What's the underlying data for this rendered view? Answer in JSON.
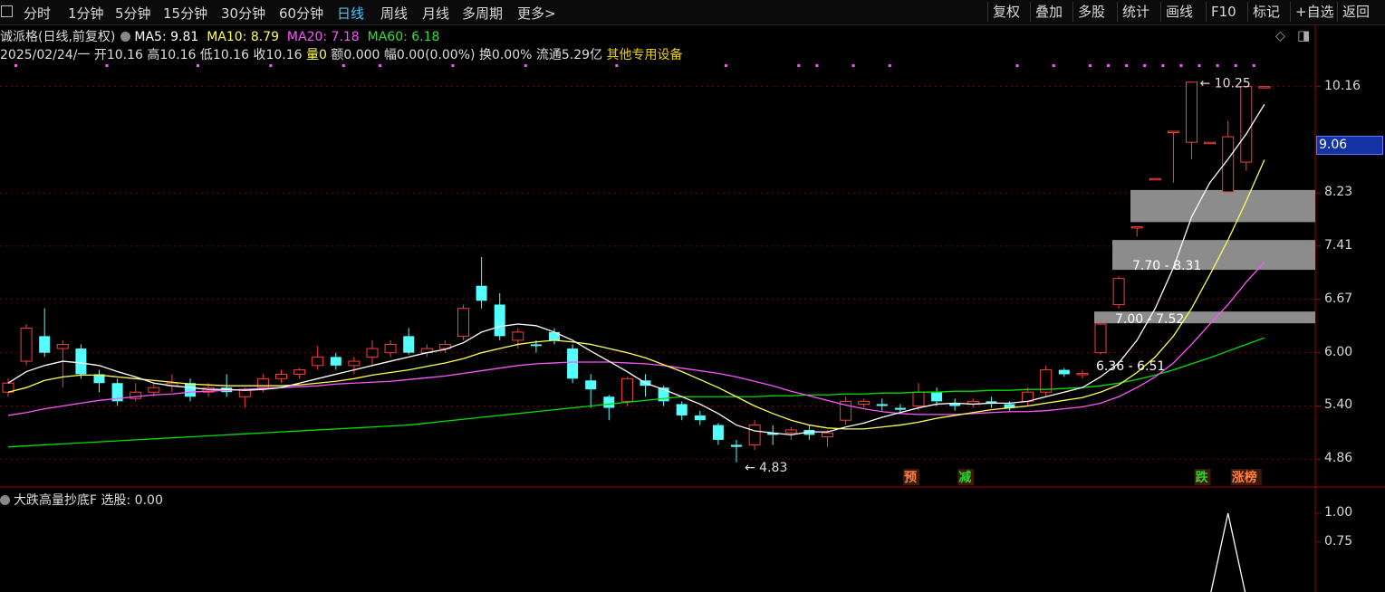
{
  "toolbar": {
    "periods": [
      "分时",
      "1分钟",
      "5分钟",
      "15分钟",
      "30分钟",
      "60分钟",
      "日线",
      "周线",
      "月线",
      "多周期",
      "更多>"
    ],
    "active_period": "日线",
    "buttons": [
      "复权",
      "叠加",
      "多股",
      "统计",
      "画线",
      "F10",
      "标记",
      "+自选",
      "返回"
    ]
  },
  "stock": {
    "name": "诚派格(日线,前复权)",
    "ma5": "MA5: 9.81",
    "ma10": "MA10: 8.79",
    "ma20": "MA20: 7.18",
    "ma60": "MA60: 6.18",
    "ohlc_line": "2025/02/24/一 开10.16 高10.16 低10.16 收10.16",
    "vol_label": "量0",
    "amount": "额0.000",
    "change": "幅0.00(0.00%)",
    "turnover": "换0.00%",
    "float_cap": "流通5.29亿",
    "sector": "其他专用设备"
  },
  "colors": {
    "up": "#ff3c3c",
    "down": "#54ffff",
    "ma5": "#ffffff",
    "ma10": "#ffff54",
    "ma20": "#ff54ff",
    "ma60": "#00e000",
    "grid": "#7a0000",
    "sector": "#e8d000",
    "highlight": "#1434a4"
  },
  "price_axis": {
    "ticks": [
      "10.16",
      "8.23",
      "7.41",
      "6.67",
      "6.00",
      "5.40",
      "4.86"
    ],
    "highlight": "9.06"
  },
  "indicator": {
    "title": "大跌高量抄底F",
    "value": "选股: 0.00",
    "ticks": [
      "1.00",
      "0.75"
    ]
  },
  "chart_data": {
    "type": "candlestick",
    "ylim": [
      4.6,
      10.6
    ],
    "candles": [
      {
        "o": 5.55,
        "c": 5.65,
        "h": 5.7,
        "l": 5.5
      },
      {
        "o": 5.9,
        "c": 6.3,
        "h": 6.35,
        "l": 5.85
      },
      {
        "o": 6.2,
        "c": 6.0,
        "h": 6.55,
        "l": 5.95
      },
      {
        "o": 6.05,
        "c": 6.1,
        "h": 6.15,
        "l": 5.6
      },
      {
        "o": 6.05,
        "c": 5.75,
        "h": 6.1,
        "l": 5.7
      },
      {
        "o": 5.75,
        "c": 5.65,
        "h": 5.8,
        "l": 5.55
      },
      {
        "o": 5.65,
        "c": 5.45,
        "h": 5.7,
        "l": 5.4
      },
      {
        "o": 5.48,
        "c": 5.55,
        "h": 5.65,
        "l": 5.45
      },
      {
        "o": 5.55,
        "c": 5.6,
        "h": 5.65,
        "l": 5.5
      },
      {
        "o": 5.62,
        "c": 5.65,
        "h": 5.75,
        "l": 5.55
      },
      {
        "o": 5.65,
        "c": 5.5,
        "h": 5.7,
        "l": 5.45
      },
      {
        "o": 5.55,
        "c": 5.6,
        "h": 5.65,
        "l": 5.5
      },
      {
        "o": 5.6,
        "c": 5.55,
        "h": 5.75,
        "l": 5.5
      },
      {
        "o": 5.5,
        "c": 5.58,
        "h": 5.6,
        "l": 5.38
      },
      {
        "o": 5.6,
        "c": 5.7,
        "h": 5.75,
        "l": 5.55
      },
      {
        "o": 5.7,
        "c": 5.75,
        "h": 5.8,
        "l": 5.65
      },
      {
        "o": 5.75,
        "c": 5.8,
        "h": 5.82,
        "l": 5.7
      },
      {
        "o": 5.85,
        "c": 5.95,
        "h": 6.08,
        "l": 5.8
      },
      {
        "o": 5.95,
        "c": 5.85,
        "h": 6.0,
        "l": 5.8
      },
      {
        "o": 5.85,
        "c": 5.9,
        "h": 5.95,
        "l": 5.75
      },
      {
        "o": 5.95,
        "c": 6.05,
        "h": 6.15,
        "l": 5.85
      },
      {
        "o": 6.0,
        "c": 6.1,
        "h": 6.15,
        "l": 5.95
      },
      {
        "o": 6.2,
        "c": 6.0,
        "h": 6.3,
        "l": 5.98
      },
      {
        "o": 6.0,
        "c": 6.05,
        "h": 6.1,
        "l": 5.95
      },
      {
        "o": 6.05,
        "c": 6.1,
        "h": 6.15,
        "l": 6.0
      },
      {
        "o": 6.2,
        "c": 6.55,
        "h": 6.6,
        "l": 6.15
      },
      {
        "o": 6.85,
        "c": 6.65,
        "h": 7.25,
        "l": 6.55
      },
      {
        "o": 6.6,
        "c": 6.2,
        "h": 6.75,
        "l": 6.15
      },
      {
        "o": 6.15,
        "c": 6.25,
        "h": 6.3,
        "l": 6.05
      },
      {
        "o": 6.1,
        "c": 6.08,
        "h": 6.15,
        "l": 6.0
      },
      {
        "o": 6.25,
        "c": 6.15,
        "h": 6.3,
        "l": 6.1
      },
      {
        "o": 6.05,
        "c": 5.7,
        "h": 6.1,
        "l": 5.65
      },
      {
        "o": 5.68,
        "c": 5.58,
        "h": 5.75,
        "l": 5.38
      },
      {
        "o": 5.5,
        "c": 5.38,
        "h": 5.52,
        "l": 5.25
      },
      {
        "o": 5.45,
        "c": 5.7,
        "h": 5.72,
        "l": 5.4
      },
      {
        "o": 5.68,
        "c": 5.62,
        "h": 5.75,
        "l": 5.5
      },
      {
        "o": 5.6,
        "c": 5.45,
        "h": 5.62,
        "l": 5.4
      },
      {
        "o": 5.42,
        "c": 5.3,
        "h": 5.45,
        "l": 5.25
      },
      {
        "o": 5.3,
        "c": 5.25,
        "h": 5.35,
        "l": 5.2
      },
      {
        "o": 5.2,
        "c": 5.05,
        "h": 5.22,
        "l": 5.0
      },
      {
        "o": 5.0,
        "c": 4.98,
        "h": 5.05,
        "l": 4.83
      },
      {
        "o": 5.0,
        "c": 5.2,
        "h": 5.25,
        "l": 4.95
      },
      {
        "o": 5.12,
        "c": 5.1,
        "h": 5.2,
        "l": 5.0
      },
      {
        "o": 5.12,
        "c": 5.15,
        "h": 5.18,
        "l": 5.05
      },
      {
        "o": 5.15,
        "c": 5.1,
        "h": 5.2,
        "l": 5.05
      },
      {
        "o": 5.08,
        "c": 5.12,
        "h": 5.15,
        "l": 4.98
      },
      {
        "o": 5.25,
        "c": 5.45,
        "h": 5.5,
        "l": 5.2
      },
      {
        "o": 5.42,
        "c": 5.45,
        "h": 5.48,
        "l": 5.38
      },
      {
        "o": 5.42,
        "c": 5.4,
        "h": 5.48,
        "l": 5.35
      },
      {
        "o": 5.38,
        "c": 5.36,
        "h": 5.42,
        "l": 5.32
      },
      {
        "o": 5.4,
        "c": 5.55,
        "h": 5.65,
        "l": 5.35
      },
      {
        "o": 5.55,
        "c": 5.45,
        "h": 5.6,
        "l": 5.4
      },
      {
        "o": 5.43,
        "c": 5.4,
        "h": 5.48,
        "l": 5.35
      },
      {
        "o": 5.42,
        "c": 5.45,
        "h": 5.48,
        "l": 5.38
      },
      {
        "o": 5.45,
        "c": 5.43,
        "h": 5.5,
        "l": 5.38
      },
      {
        "o": 5.42,
        "c": 5.38,
        "h": 5.45,
        "l": 5.35
      },
      {
        "o": 5.45,
        "c": 5.55,
        "h": 5.6,
        "l": 5.4
      },
      {
        "o": 5.55,
        "c": 5.8,
        "h": 5.85,
        "l": 5.5
      },
      {
        "o": 5.8,
        "c": 5.75,
        "h": 5.82,
        "l": 5.72
      },
      {
        "o": 5.75,
        "c": 5.76,
        "h": 5.8,
        "l": 5.7
      },
      {
        "o": 6.0,
        "c": 6.35,
        "h": 6.38,
        "l": 5.98
      },
      {
        "o": 6.6,
        "c": 6.95,
        "h": 6.98,
        "l": 6.55
      },
      {
        "o": 7.7,
        "c": 7.7,
        "h": 7.7,
        "l": 7.55
      },
      {
        "o": 8.47,
        "c": 8.47,
        "h": 8.47,
        "l": 8.47
      },
      {
        "o": 9.3,
        "c": 9.3,
        "h": 9.3,
        "l": 8.4
      },
      {
        "o": 9.1,
        "c": 10.25,
        "h": 10.25,
        "l": 8.8
      },
      {
        "o": 9.1,
        "c": 9.1,
        "h": 9.1,
        "l": 9.1
      },
      {
        "o": 8.25,
        "c": 9.2,
        "h": 9.5,
        "l": 8.25
      },
      {
        "o": 8.75,
        "c": 10.16,
        "h": 10.16,
        "l": 8.6
      },
      {
        "o": 10.16,
        "c": 10.16,
        "h": 10.16,
        "l": 10.16
      }
    ],
    "ma5": [
      5.65,
      5.78,
      5.85,
      5.9,
      5.88,
      5.85,
      5.78,
      5.72,
      5.65,
      5.62,
      5.6,
      5.58,
      5.58,
      5.57,
      5.58,
      5.6,
      5.65,
      5.7,
      5.75,
      5.8,
      5.85,
      5.9,
      5.95,
      6.0,
      6.04,
      6.12,
      6.25,
      6.32,
      6.35,
      6.33,
      6.25,
      6.15,
      6.02,
      5.9,
      5.78,
      5.65,
      5.58,
      5.5,
      5.42,
      5.32,
      5.2,
      5.14,
      5.12,
      5.1,
      5.13,
      5.13,
      5.18,
      5.22,
      5.28,
      5.33,
      5.38,
      5.42,
      5.43,
      5.42,
      5.43,
      5.43,
      5.45,
      5.5,
      5.55,
      5.6,
      5.72,
      5.88,
      6.15,
      6.55,
      7.1,
      7.85,
      8.4,
      8.8,
      9.25,
      9.81
    ],
    "ma10": [
      5.55,
      5.6,
      5.68,
      5.72,
      5.74,
      5.74,
      5.72,
      5.7,
      5.68,
      5.66,
      5.64,
      5.63,
      5.62,
      5.62,
      5.62,
      5.62,
      5.63,
      5.65,
      5.67,
      5.7,
      5.74,
      5.77,
      5.8,
      5.84,
      5.88,
      5.93,
      6.0,
      6.05,
      6.1,
      6.13,
      6.15,
      6.13,
      6.1,
      6.05,
      6.0,
      5.94,
      5.86,
      5.78,
      5.69,
      5.6,
      5.5,
      5.4,
      5.32,
      5.25,
      5.2,
      5.17,
      5.16,
      5.16,
      5.18,
      5.2,
      5.23,
      5.27,
      5.3,
      5.33,
      5.36,
      5.38,
      5.4,
      5.43,
      5.46,
      5.49,
      5.55,
      5.63,
      5.77,
      5.95,
      6.2,
      6.55,
      7.0,
      7.5,
      8.1,
      8.79
    ],
    "ma20": [
      5.3,
      5.33,
      5.37,
      5.4,
      5.43,
      5.46,
      5.48,
      5.5,
      5.52,
      5.53,
      5.55,
      5.56,
      5.57,
      5.58,
      5.59,
      5.6,
      5.61,
      5.62,
      5.64,
      5.65,
      5.66,
      5.67,
      5.69,
      5.71,
      5.73,
      5.76,
      5.79,
      5.82,
      5.85,
      5.87,
      5.88,
      5.89,
      5.89,
      5.89,
      5.88,
      5.87,
      5.85,
      5.82,
      5.79,
      5.76,
      5.72,
      5.67,
      5.62,
      5.56,
      5.51,
      5.46,
      5.41,
      5.37,
      5.34,
      5.32,
      5.31,
      5.31,
      5.31,
      5.32,
      5.33,
      5.34,
      5.34,
      5.35,
      5.37,
      5.39,
      5.43,
      5.5,
      5.6,
      5.72,
      5.88,
      6.1,
      6.35,
      6.6,
      6.9,
      7.18
    ],
    "ma60": [
      4.98,
      4.99,
      5.0,
      5.01,
      5.02,
      5.03,
      5.04,
      5.05,
      5.06,
      5.07,
      5.08,
      5.09,
      5.1,
      5.11,
      5.12,
      5.13,
      5.14,
      5.15,
      5.16,
      5.17,
      5.18,
      5.19,
      5.2,
      5.22,
      5.24,
      5.26,
      5.28,
      5.3,
      5.32,
      5.34,
      5.36,
      5.38,
      5.4,
      5.42,
      5.44,
      5.46,
      5.48,
      5.5,
      5.5,
      5.5,
      5.5,
      5.5,
      5.51,
      5.51,
      5.52,
      5.52,
      5.53,
      5.53,
      5.54,
      5.54,
      5.55,
      5.55,
      5.56,
      5.56,
      5.57,
      5.57,
      5.58,
      5.58,
      5.59,
      5.6,
      5.62,
      5.65,
      5.69,
      5.74,
      5.8,
      5.87,
      5.94,
      6.02,
      6.1,
      6.18
    ],
    "zones": [
      {
        "label": "",
        "low": 7.77,
        "high": 8.28
      },
      {
        "label": "7.70 - 8.31",
        "low": 7.07,
        "high": 7.5
      },
      {
        "label": "6.36 - 6.51",
        "low": 6.36,
        "high": 6.51
      }
    ],
    "zone_extra_labels": [
      {
        "text": "7.00 - 7.52",
        "price": 6.9
      }
    ],
    "annotations": [
      {
        "text": "10.25",
        "price": 10.25,
        "index": 65
      },
      {
        "text": "4.83",
        "price": 4.83,
        "index": 40
      }
    ],
    "signals": [
      {
        "text": "预",
        "index": 50,
        "color": "#ff8040"
      },
      {
        "text": "减",
        "index": 53,
        "color": "#30d030"
      },
      {
        "text": "跌",
        "index": 66,
        "color": "#30d030"
      },
      {
        "text": "涨榜",
        "index": 68,
        "color": "#ff8040"
      }
    ],
    "indicator_series": [
      0,
      0,
      0,
      0,
      0,
      0,
      0,
      0,
      0,
      0,
      0,
      0,
      0,
      0,
      0,
      0,
      0,
      0,
      0,
      0,
      0,
      0,
      0,
      0,
      0,
      0,
      0,
      0,
      0,
      0,
      0,
      0,
      0,
      0,
      0,
      0,
      0,
      0,
      0,
      0,
      0,
      0,
      0,
      0,
      0,
      0,
      0,
      0,
      0,
      0,
      0,
      0,
      0,
      0,
      0,
      0,
      0,
      0,
      0,
      0,
      0,
      0,
      0,
      0,
      0,
      0,
      0,
      1,
      0,
      0
    ],
    "indicator_ylim": [
      0,
      1.1
    ]
  }
}
